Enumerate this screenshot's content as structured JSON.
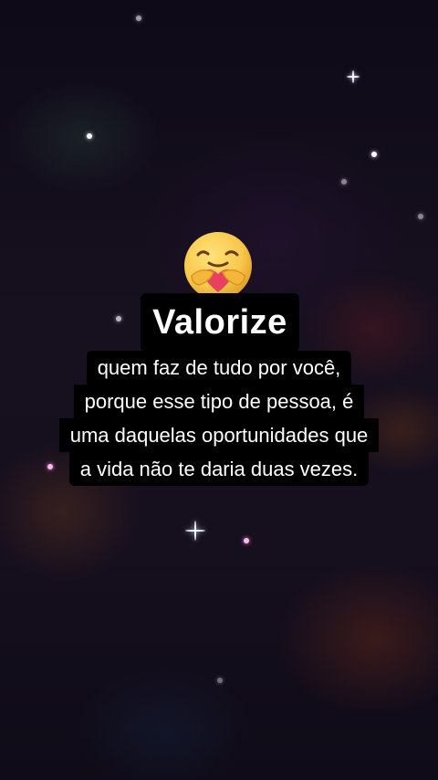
{
  "post": {
    "title": "Valorize",
    "lines": [
      "quem faz de tudo por você,",
      "porque esse tipo de pessoa, é",
      "uma daquelas oportunidades que",
      "a vida não te daria duas vezes."
    ],
    "emoji": "care-hug-emoji"
  },
  "colors": {
    "text": "#ffffff",
    "caption_bg": "#000000",
    "emoji_face": "#f7c84c",
    "heart": "#e8405e"
  }
}
